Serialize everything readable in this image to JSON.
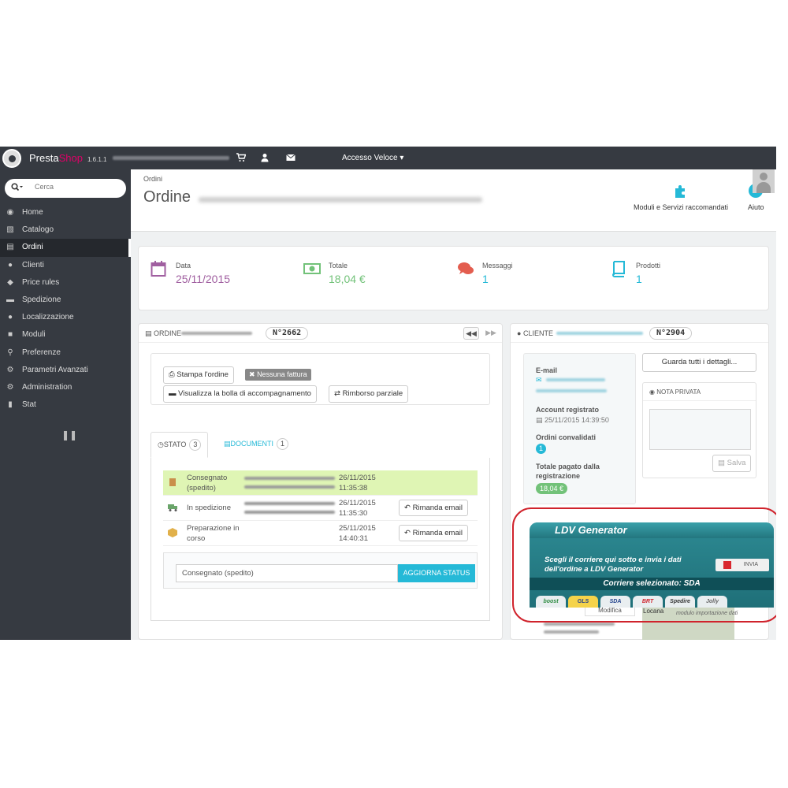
{
  "topbar": {
    "brand_a": "Presta",
    "brand_b": "Shop",
    "version": "1.6.1.1",
    "quick_access": "Accesso Veloce ▾"
  },
  "sidebar": {
    "search_placeholder": "Cerca",
    "items": [
      {
        "label": "Home",
        "icon": "dashboard-icon"
      },
      {
        "label": "Catalogo",
        "icon": "book-icon"
      },
      {
        "label": "Ordini",
        "icon": "credit-card-icon"
      },
      {
        "label": "Clienti",
        "icon": "users-icon"
      },
      {
        "label": "Price rules",
        "icon": "tag-icon"
      },
      {
        "label": "Spedizione",
        "icon": "truck-icon"
      },
      {
        "label": "Localizzazione",
        "icon": "globe-icon"
      },
      {
        "label": "Moduli",
        "icon": "puzzle-icon"
      },
      {
        "label": "Preferenze",
        "icon": "wrench-icon"
      },
      {
        "label": "Parametri Avanzati",
        "icon": "cogs-icon"
      },
      {
        "label": "Administration",
        "icon": "gear-icon"
      },
      {
        "label": "Stat",
        "icon": "bar-chart-icon"
      }
    ]
  },
  "header": {
    "breadcrumb": "Ordini",
    "title": "Ordine",
    "tool_modules": "Moduli e Servizi raccomandati",
    "tool_help": "Aiuto"
  },
  "kpi": {
    "date_label": "Data",
    "date_value": "25/11/2015",
    "total_label": "Totale",
    "total_value": "18,04 €",
    "messages_label": "Messaggi",
    "messages_value": "1",
    "products_label": "Prodotti",
    "products_value": "1",
    "colors": {
      "date": "#a05fa0",
      "total": "#72c279",
      "messages": "#e35d4f",
      "products": "#25b9d7"
    }
  },
  "order": {
    "title": "Ordine",
    "number": "N°2662",
    "btn_print": "Stampa l'ordine",
    "btn_no_invoice": "Nessuna fattura",
    "btn_delivery": "Visualizza la bolla di accompagnamento",
    "btn_refund": "Rimborso parziale",
    "tab_status": "Stato",
    "tab_status_count": "3",
    "tab_docs": "Documenti",
    "tab_docs_count": "1",
    "history": [
      {
        "name": "Consegnato (spedito)",
        "date": "26/11/2015",
        "time": "11:35:38",
        "action": ""
      },
      {
        "name": "In spedizione",
        "date": "26/11/2015",
        "time": "11:35:30",
        "action": "Rimanda email"
      },
      {
        "name": "Preparazione in corso",
        "date": "25/11/2015",
        "time": "14:40:31",
        "action": "Rimanda email"
      }
    ],
    "status_selected": "Consegnato (spedito)",
    "btn_update": "AGGIORNA STATUS"
  },
  "customer": {
    "title": "Cliente",
    "number": "N°2904",
    "btn_details": "Guarda tutti i dettagli...",
    "email_label": "E-mail",
    "registered_label": "Account registrato",
    "registered_value": "25/11/2015 14:39:50",
    "orders_label": "Ordini convalidati",
    "orders_value": "1",
    "paid_label": "Totale pagato dalla registrazione",
    "paid_value": "18,04 €",
    "note_title": "NOTA PRIVATA",
    "note_save": "Salva"
  },
  "ldv": {
    "title": "LDV Generator",
    "text": "Scegli il corriere qui sotto e invia i dati dell'ordine a LDV Generator",
    "send": "INVIA",
    "selected": "Corriere selezionato: SDA",
    "carriers": [
      "boost",
      "GLS",
      "SDA",
      "BRT",
      "Spedire",
      "Jolly"
    ],
    "under_modifica": "Modifica",
    "under_locana": "Locana",
    "under_import": "modulo importazione dati"
  }
}
